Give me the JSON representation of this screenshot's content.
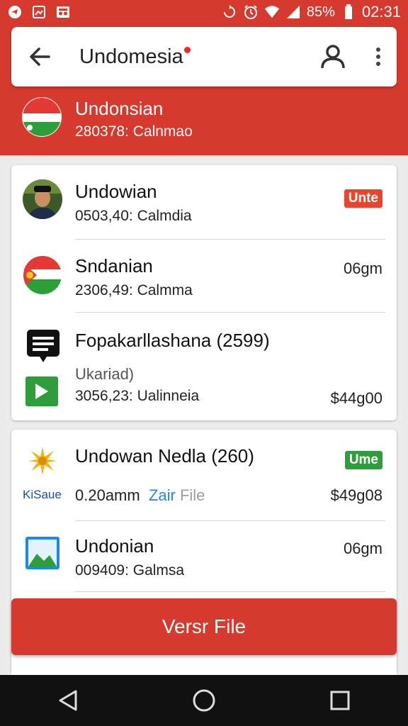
{
  "status_bar": {
    "battery": "85%",
    "time": "02:31",
    "icons": [
      "telegram-icon",
      "gallery-icon",
      "incognito-icon",
      "sync-icon",
      "alarm-icon",
      "wifi-icon",
      "signal-icon",
      "battery-icon"
    ]
  },
  "search": {
    "query": "Undomesia"
  },
  "header_item": {
    "name": "Undonsian",
    "subtitle": "280378: Calnmao"
  },
  "card1": {
    "items": [
      {
        "title": "Undowian",
        "subtitle": "0503,40: Calmdia",
        "badge": "Unte"
      },
      {
        "title": "Sndanian",
        "subtitle": "2306,49: Calmma",
        "right": "06gm"
      },
      {
        "title": "Fopakarllashana (2599)",
        "label": "Ukariad)",
        "subtitle": "3056,23: Ualinneia",
        "right": "$44g00"
      }
    ]
  },
  "card2": {
    "items": [
      {
        "title": "Undowan Nedla (260)",
        "logo_text": "KiSaue",
        "subtitle": "0.20amm",
        "link": "Zair",
        "link_suffix": "File",
        "badge": "Ume",
        "right": "$49g08"
      },
      {
        "title": "Undonian",
        "subtitle": "009409: Galmsa",
        "right": "06gm"
      }
    ]
  },
  "cta": {
    "label": "Versr File"
  },
  "colors": {
    "primary": "#d63a2f",
    "badge_red": "#e8452c",
    "badge_green": "#2e9e3b",
    "link": "#1e88e5"
  }
}
